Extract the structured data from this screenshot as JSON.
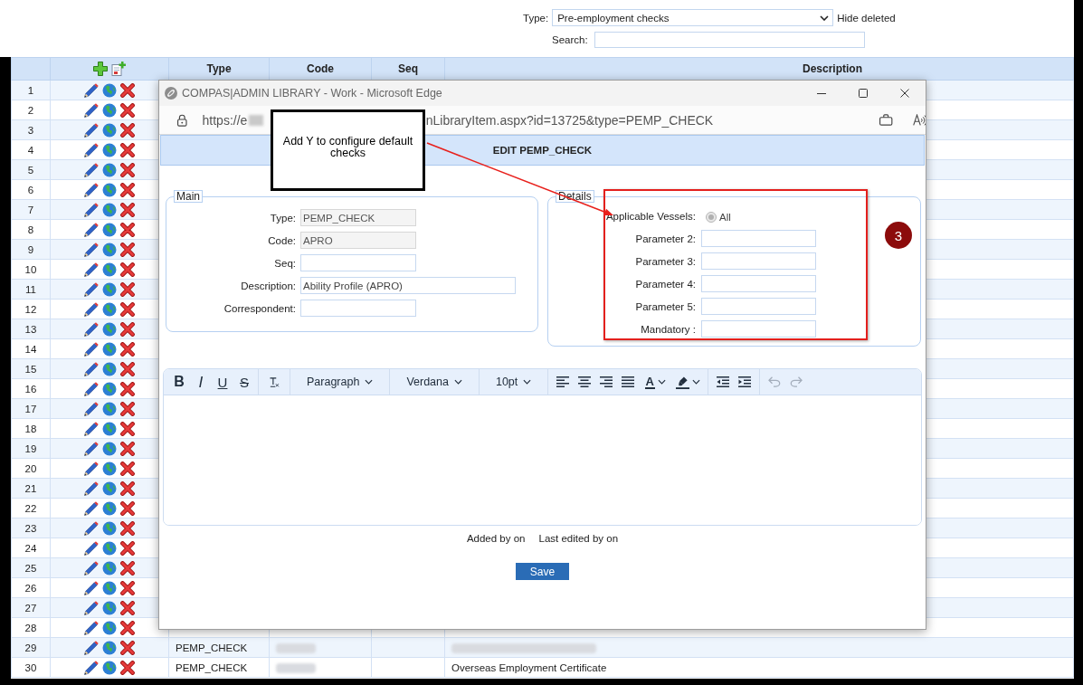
{
  "filter": {
    "type_label": "Type:",
    "type_value": "Pre-employment checks",
    "hide_deleted": "Hide deleted",
    "search_label": "Search:"
  },
  "table": {
    "columns": [
      "Type",
      "Code",
      "Seq",
      "Description"
    ],
    "rows": [
      {
        "number": "1"
      },
      {
        "number": "2"
      },
      {
        "number": "3"
      },
      {
        "number": "4"
      },
      {
        "number": "5"
      },
      {
        "number": "6"
      },
      {
        "number": "7"
      },
      {
        "number": "8"
      },
      {
        "number": "9"
      },
      {
        "number": "10"
      },
      {
        "number": "11"
      },
      {
        "number": "12"
      },
      {
        "number": "13"
      },
      {
        "number": "14"
      },
      {
        "number": "15"
      },
      {
        "number": "16"
      },
      {
        "number": "17"
      },
      {
        "number": "18"
      },
      {
        "number": "19"
      },
      {
        "number": "20"
      },
      {
        "number": "21"
      },
      {
        "number": "22"
      },
      {
        "number": "23"
      },
      {
        "number": "24"
      },
      {
        "number": "25"
      },
      {
        "number": "26"
      },
      {
        "number": "27"
      },
      {
        "number": "28"
      },
      {
        "number": "29",
        "type": "PEMP_CHECK",
        "code_redacted": true,
        "description_redacted": true
      },
      {
        "number": "30",
        "type": "PEMP_CHECK",
        "code_redacted": true,
        "description": "Overseas Employment Certificate"
      }
    ]
  },
  "popup": {
    "title": "COMPAS|ADMIN LIBRARY - Work - Microsoft Edge",
    "url_start": "https://e",
    "url_redacted": true,
    "url_end": "nLibraryItem.aspx?id=13725&type=PEMP_CHECK",
    "heading": "EDIT PEMP_CHECK",
    "main": {
      "legend": "Main",
      "fields": [
        {
          "label": "Type:",
          "value": "PEMP_CHECK",
          "disabled": true,
          "kind": "short"
        },
        {
          "label": "Code:",
          "value": "APRO",
          "disabled": true,
          "kind": "short"
        },
        {
          "label": "Seq:",
          "disabled": false,
          "kind": "short"
        },
        {
          "label": "Description:",
          "value": "Ability Profile (APRO)",
          "disabled": false,
          "kind": "long"
        },
        {
          "label": "Correspondent:",
          "disabled": false,
          "kind": "short"
        }
      ]
    },
    "details": {
      "legend": "Details",
      "vessels": {
        "label": "Applicable Vessels:",
        "option": "All",
        "selected": true,
        "disabled": true
      },
      "fields": [
        {
          "label": "Parameter 2:"
        },
        {
          "label": "Parameter 3:"
        },
        {
          "label": "Parameter 4:"
        },
        {
          "label": "Parameter 5:"
        },
        {
          "label": "Mandatory :"
        }
      ]
    },
    "editor": {
      "toolbar": [
        [
          {
            "kind": "bold",
            "label": "B",
            "disabled": false
          },
          {
            "kind": "italic",
            "label": "I",
            "disabled": false
          },
          {
            "kind": "underline",
            "label": "U",
            "disabled": false
          },
          {
            "kind": "strikethrough",
            "label": "S",
            "disabled": false
          }
        ],
        [
          {
            "kind": "clear_format",
            "disabled": false
          }
        ],
        [
          {
            "kind": "dropdown",
            "label": "Paragraph",
            "disabled": false
          }
        ],
        [
          {
            "kind": "dropdown",
            "label": "Verdana",
            "disabled": false
          }
        ],
        [
          {
            "kind": "dropdown",
            "label": "10pt",
            "disabled": false
          }
        ],
        [
          {
            "kind": "align_left",
            "disabled": false
          },
          {
            "kind": "align_center",
            "disabled": false
          },
          {
            "kind": "align_right",
            "disabled": false
          },
          {
            "kind": "justify",
            "disabled": false
          },
          {
            "kind": "font_color",
            "label": "A",
            "disabled": false
          },
          {
            "kind": "highlight",
            "disabled": false
          }
        ],
        [
          {
            "kind": "outdent",
            "disabled": false
          },
          {
            "kind": "indent",
            "disabled": false
          }
        ],
        [
          {
            "kind": "undo",
            "disabled": true
          },
          {
            "kind": "redo",
            "disabled": true
          }
        ]
      ]
    },
    "added_by": "Added by on",
    "last_edited": "Last edited by on",
    "save": "Save"
  },
  "annotation": {
    "callout": "Add Y to configure default checks",
    "step": "3"
  }
}
